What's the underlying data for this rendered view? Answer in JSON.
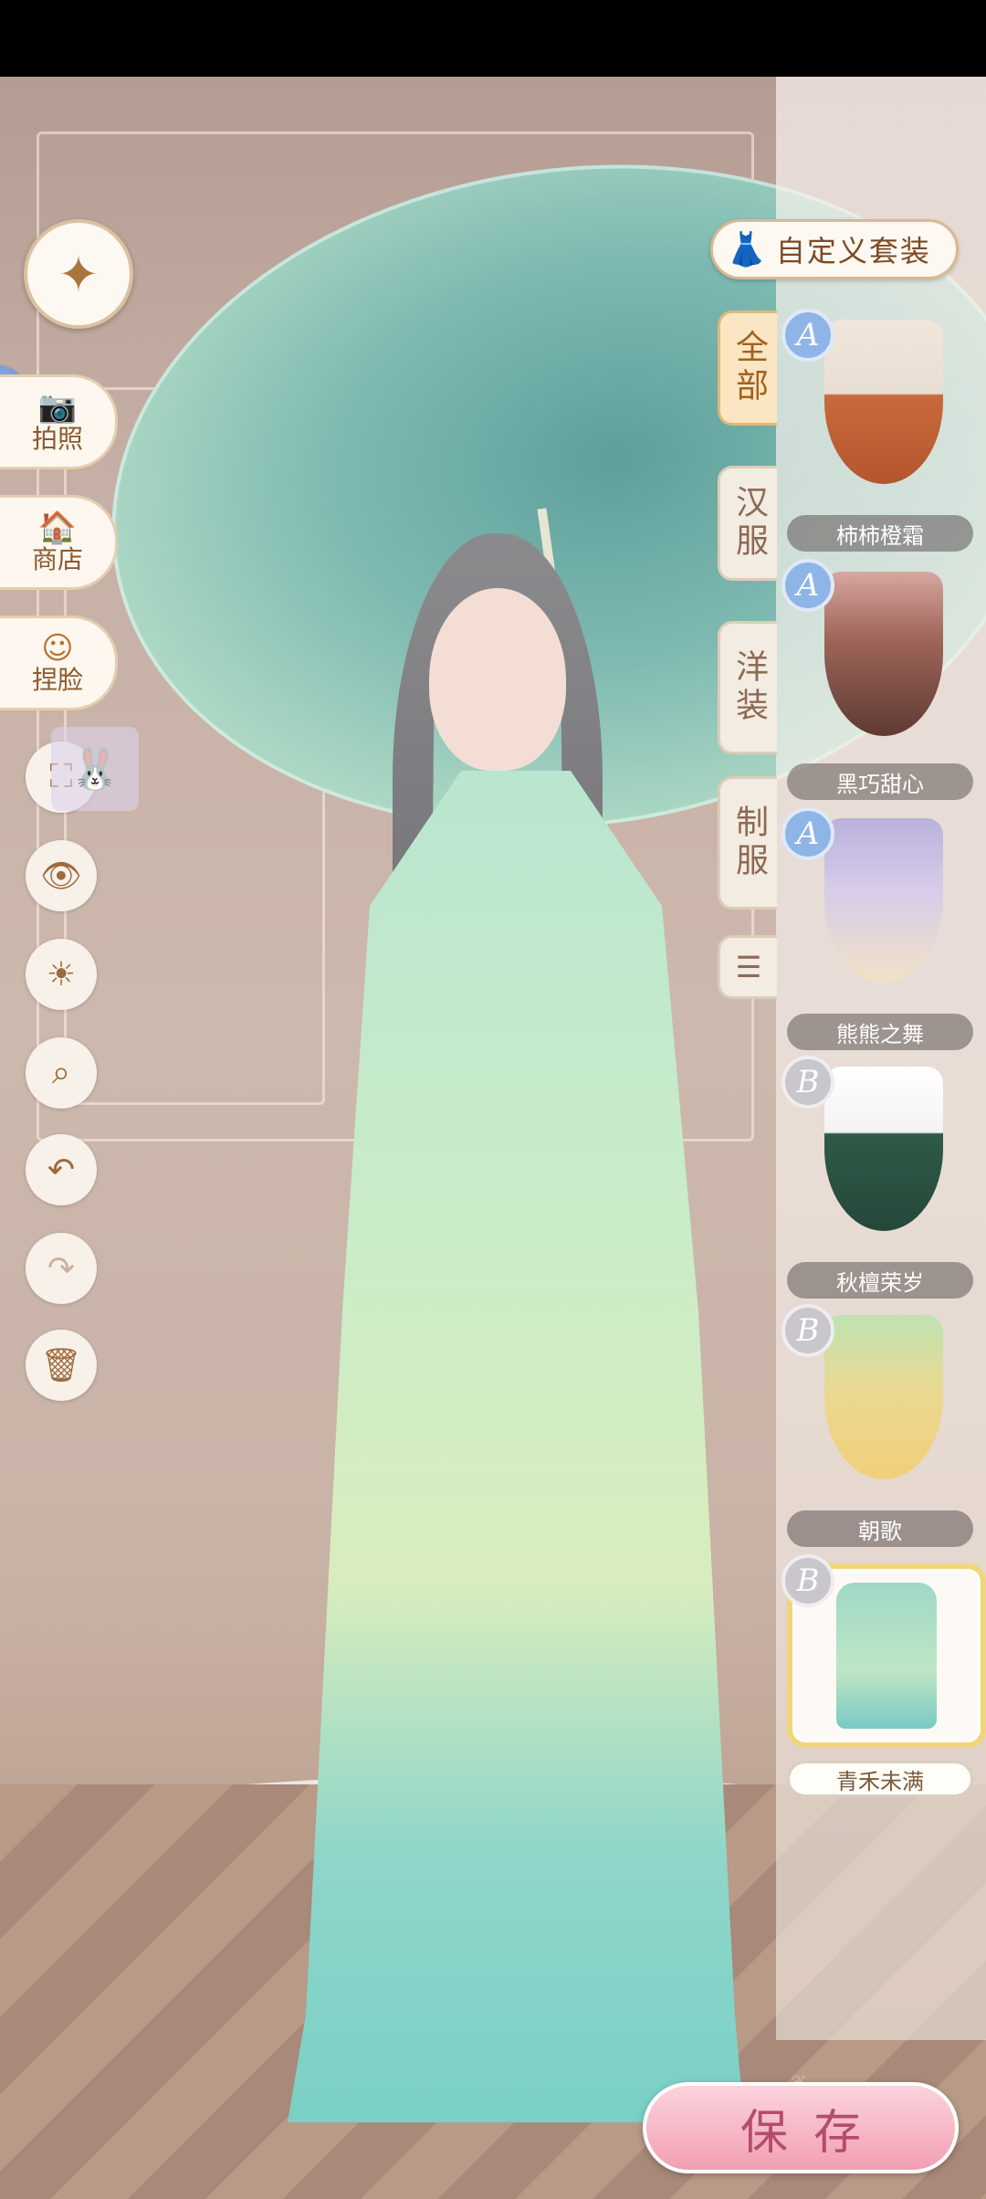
{
  "left_menu": {
    "back_icon": "compass-star-icon",
    "photo_label": "拍照",
    "shop_label": "商店",
    "face_label": "捏脸",
    "tools": [
      "camera-frame-icon",
      "eye-icon",
      "sun-icon",
      "zoom-icon",
      "undo-icon",
      "redo-icon",
      "trash-icon"
    ]
  },
  "right_panel": {
    "custom_outfit_label": "自定义套装",
    "categories": [
      "全部",
      "汉服",
      "洋装",
      "制服"
    ],
    "filter_icon": "sort-filter-icon",
    "outfits": [
      {
        "name": "柿柿橙霜",
        "rank": "A"
      },
      {
        "name": "黑巧甜心",
        "rank": "A"
      },
      {
        "name": "熊熊之舞",
        "rank": "A"
      },
      {
        "name": "秋檀荣岁",
        "rank": "B"
      },
      {
        "name": "朝歌",
        "rank": "B"
      },
      {
        "name": "青禾未满",
        "rank": "B"
      }
    ]
  },
  "save_label": "保存",
  "colors": {
    "accent": "#a3611f",
    "save_pink": "#f29fb3",
    "rank_a": "#8fb5e8",
    "rank_b": "#c9c6cc",
    "selected_border": "#f2d57a"
  }
}
